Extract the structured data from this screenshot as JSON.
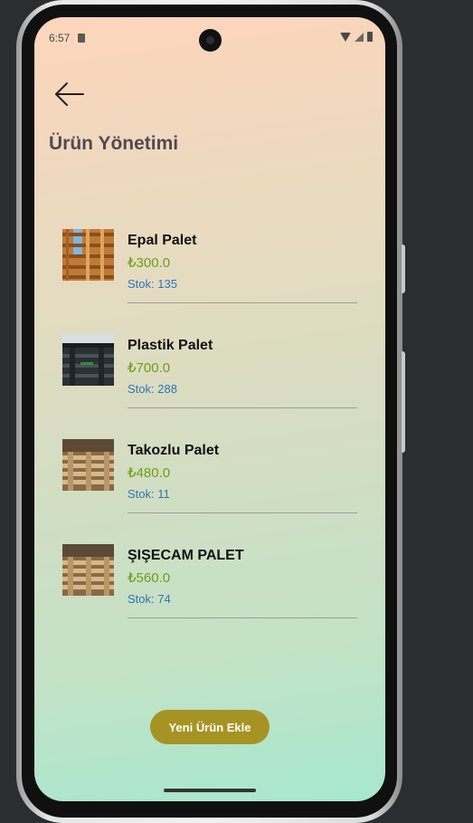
{
  "status_bar": {
    "time": "6:57"
  },
  "header": {
    "title": "Ürün Yönetimi"
  },
  "products": [
    {
      "name": "Epal Palet",
      "price": "₺300.0",
      "stock": "Stok: 135"
    },
    {
      "name": "Plastik Palet",
      "price": "₺700.0",
      "stock": "Stok: 288"
    },
    {
      "name": "Takozlu Palet",
      "price": "₺480.0",
      "stock": "Stok: 11"
    },
    {
      "name": "ŞIŞECAM PALET",
      "price": "₺560.0",
      "stock": "Stok: 74"
    }
  ],
  "actions": {
    "add_product_label": "Yeni Ürün Ekle"
  },
  "colors": {
    "accent": "#a79323",
    "price": "#6aa01a",
    "stock": "#2f74b5",
    "title": "#4f4a52"
  }
}
